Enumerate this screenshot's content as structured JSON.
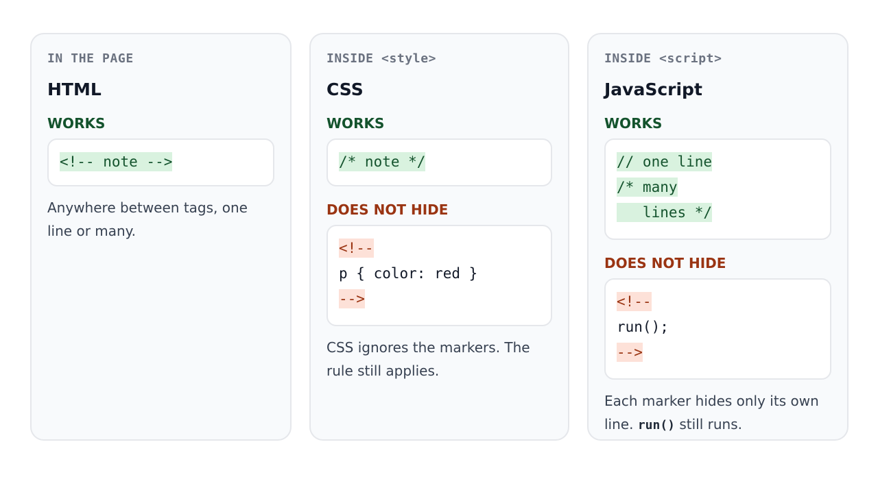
{
  "cards": [
    {
      "context": "IN THE PAGE",
      "language": "HTML",
      "works_label": "WORKS",
      "works_lines": [
        "<!-- note -->"
      ],
      "description": "Anywhere between tags, one line or many."
    },
    {
      "context": "INSIDE <style>",
      "language": "CSS",
      "works_label": "WORKS",
      "works_lines": [
        "/* note */"
      ],
      "fails_label": "DOES NOT HIDE",
      "fails_lines": [
        "<!--",
        "p { color: red }",
        "-->"
      ],
      "description": "CSS ignores the markers. The rule still applies."
    },
    {
      "context": "INSIDE <script>",
      "language": "JavaScript",
      "works_label": "WORKS",
      "works_lines": [
        "// one line",
        "/* many",
        "   lines */"
      ],
      "fails_label": "DOES NOT HIDE",
      "fails_lines": [
        "<!--",
        "run();",
        "-->"
      ],
      "description_before": "Each marker hides only its own line.",
      "description_code": "run()",
      "description_after": "still runs."
    }
  ]
}
